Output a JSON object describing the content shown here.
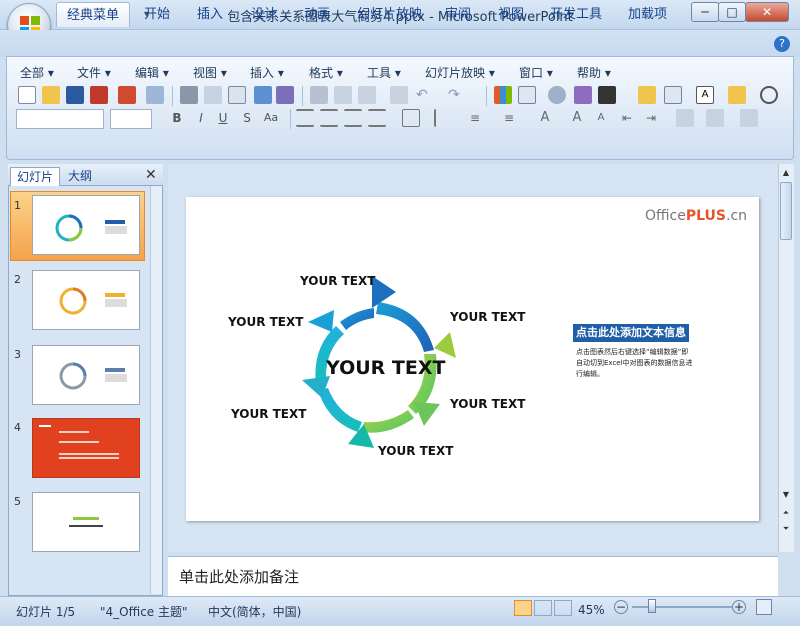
{
  "window": {
    "title": "包含关系关系图表大气商务4.pptx - Microsoft PowerPoint",
    "min_label": "─",
    "max_label": "□",
    "close_label": "✕"
  },
  "tabs": [
    "经典菜单",
    "开始",
    "插入",
    "设计",
    "动画",
    "幻灯片放映",
    "审阅",
    "视图",
    "开发工具",
    "加载项"
  ],
  "classic_menu": [
    "全部 ▾",
    "文件 ▾",
    "编辑 ▾",
    "视图 ▾",
    "插入 ▾",
    "格式 ▾",
    "工具 ▾",
    "幻灯片放映 ▾",
    "窗口 ▾",
    "帮助 ▾"
  ],
  "left_panel": {
    "tabs": [
      "幻灯片",
      "大纲"
    ],
    "close": "✕",
    "slides": [
      "1",
      "2",
      "3",
      "4",
      "5"
    ]
  },
  "slide": {
    "logo_office": "Office",
    "logo_plus": "PLUS",
    "logo_cn": ".cn",
    "center": "YOUR TEXT",
    "labels": [
      "YOUR TEXT",
      "YOUR TEXT",
      "YOUR TEXT",
      "YOUR TEXT",
      "YOUR TEXT",
      "YOUR TEXT"
    ],
    "info_title": "点击此处添加文本信息",
    "info_body": "点击图表然后右键选择“编辑数据”即自动切到Excel中对图表的数据信息进行编辑。"
  },
  "notes_placeholder": "单击此处添加备注",
  "status": {
    "slide": "幻灯片 1/5",
    "theme": "\"4_Office 主题\"",
    "language": "中文(简体，中国)",
    "zoom": "45%"
  },
  "colors": {
    "arrow_blue": "#1f6fc1",
    "arrow_teal": "#22b0c8",
    "arrow_green": "#8dc63f",
    "accent_orange": "#f5a24b",
    "slide4_red": "#e2411f"
  }
}
